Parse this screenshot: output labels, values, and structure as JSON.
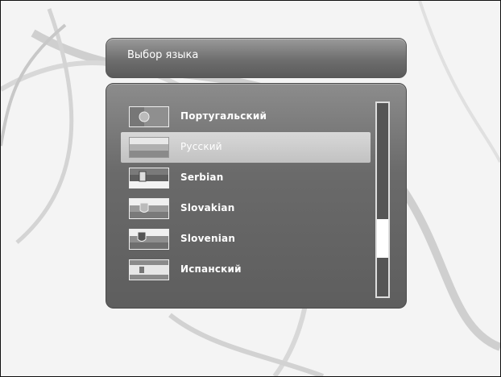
{
  "dialog": {
    "title": "Выбор языка"
  },
  "languages": [
    {
      "label": "Португальский",
      "flag": "portugal-flag-icon"
    },
    {
      "label": "Русский",
      "flag": "russia-flag-icon",
      "selected": true
    },
    {
      "label": "Serbian",
      "flag": "serbia-flag-icon"
    },
    {
      "label": "Slovakian",
      "flag": "slovakia-flag-icon"
    },
    {
      "label": "Slovenian",
      "flag": "slovenia-flag-icon"
    },
    {
      "label": "Испанский",
      "flag": "spain-flag-icon"
    }
  ],
  "scrollbar": {
    "thumb_start_fraction": 0.6,
    "thumb_end_fraction": 0.8
  },
  "colors": {
    "panel": "#6a6a6a",
    "selection": "#c8c8c8",
    "text": "#ffffff"
  }
}
